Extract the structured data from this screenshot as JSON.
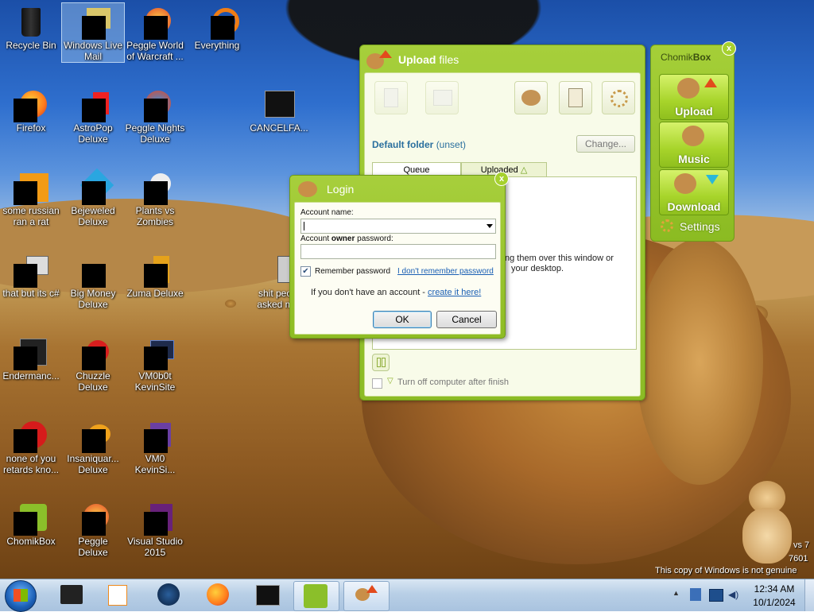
{
  "desktop": {
    "icons": [
      {
        "label": "Recycle Bin"
      },
      {
        "label": "Windows Live Mail"
      },
      {
        "label": "Peggle World of Warcraft ..."
      },
      {
        "label": "Everything"
      },
      {
        "label": "Firefox"
      },
      {
        "label": "AstroPop Deluxe"
      },
      {
        "label": "Peggle Nights Deluxe"
      },
      {
        "label": "CANCELFA..."
      },
      {
        "label": "some russian ran a rat"
      },
      {
        "label": "Bejeweled Deluxe"
      },
      {
        "label": "Plants vs Zombies"
      },
      {
        "label": "that but its c#"
      },
      {
        "label": "Big Money Deluxe"
      },
      {
        "label": "Zuma Deluxe"
      },
      {
        "label": "shit peo... asked m..."
      },
      {
        "label": "Endermanc..."
      },
      {
        "label": "Chuzzle Deluxe"
      },
      {
        "label": "VM0b0t KevinSite"
      },
      {
        "label": "none of you retards kno..."
      },
      {
        "label": "Insaniquar... Deluxe"
      },
      {
        "label": "VM0 KevinSi..."
      },
      {
        "label": "ChomikBox"
      },
      {
        "label": "Peggle Deluxe"
      },
      {
        "label": "Visual Studio 2015"
      }
    ],
    "watermark": {
      "line1": "vs 7",
      "line2": "7601",
      "line3": "This copy of Windows is not genuine"
    }
  },
  "upload_window": {
    "title_bold": "Upload",
    "title_rest": "files",
    "default_folder_label": "Default folder",
    "default_folder_value": "(unset)",
    "change_button": "Change...",
    "tabs": [
      "Queue",
      "Uploaded"
    ],
    "drop_hint_line1": "ng them over this window or",
    "drop_hint_line2": "your desktop.",
    "turn_off_label": "Turn off computer after finish"
  },
  "chomikbox_panel": {
    "title_normal": "Chomik",
    "title_bold": "Box",
    "buttons": [
      "Upload",
      "Music",
      "Download"
    ],
    "settings_label": "Settings"
  },
  "login_dialog": {
    "title": "Login",
    "account_name_label": "Account name:",
    "account_name_value": "",
    "password_label_pre": "Account ",
    "password_label_bold": "owner",
    "password_label_post": " password:",
    "password_value": "",
    "remember_label": "Remember password",
    "remember_checked": true,
    "forgot_link": "I don't remember password",
    "no_account_text": "If you don't have an account - ",
    "create_link": "create it here!",
    "ok_button": "OK",
    "cancel_button": "Cancel"
  },
  "taskbar": {
    "time": "12:34 AM",
    "date": "10/1/2024",
    "pinned": [
      "explorer",
      "media-player",
      "unknown-app",
      "firefox",
      "cmd",
      "chomikbox",
      "upload-files"
    ]
  },
  "colors": {
    "chomik_green": "#9cc632",
    "link_blue": "#1a5fb4",
    "folder_label_blue": "#2a6f9e"
  }
}
